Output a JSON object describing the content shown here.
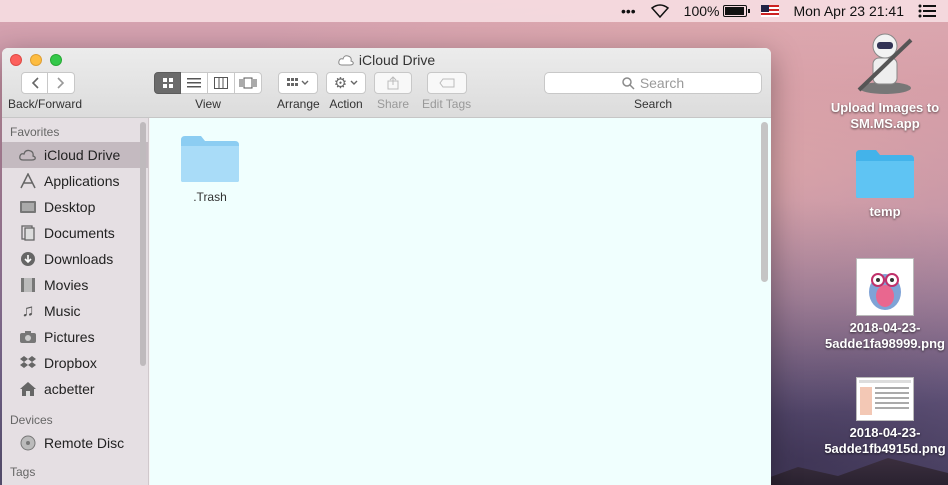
{
  "menubar": {
    "battery_percent_label": "100%",
    "battery_level": 1.0,
    "datetime": "Mon Apr 23  21:41"
  },
  "window": {
    "title": "iCloud Drive",
    "toolbar": {
      "back_forward_label": "Back/Forward",
      "view_label": "View",
      "arrange_label": "Arrange",
      "action_label": "Action",
      "share_label": "Share",
      "edit_tags_label": "Edit Tags",
      "search_label": "Search",
      "search_placeholder": "Search"
    }
  },
  "sidebar": {
    "favorites_heading": "Favorites",
    "favorites": [
      {
        "label": "iCloud Drive",
        "icon": "cloud-icon",
        "selected": true
      },
      {
        "label": "Applications",
        "icon": "applications-icon"
      },
      {
        "label": "Desktop",
        "icon": "desktop-icon"
      },
      {
        "label": "Documents",
        "icon": "documents-icon"
      },
      {
        "label": "Downloads",
        "icon": "downloads-icon"
      },
      {
        "label": "Movies",
        "icon": "movies-icon"
      },
      {
        "label": "Music",
        "icon": "music-icon"
      },
      {
        "label": "Pictures",
        "icon": "pictures-icon"
      },
      {
        "label": "Dropbox",
        "icon": "dropbox-icon"
      },
      {
        "label": "acbetter",
        "icon": "home-icon"
      }
    ],
    "devices_heading": "Devices",
    "devices": [
      {
        "label": "Remote Disc",
        "icon": "disc-icon"
      }
    ],
    "tags_heading": "Tags"
  },
  "content": {
    "items": [
      {
        "name": ".Trash",
        "icon": "folder-icon"
      }
    ]
  },
  "desktop": {
    "icons": [
      {
        "label": "Upload Images to SM.MS.app",
        "icon": "automator-robot-icon"
      },
      {
        "label": "temp",
        "icon": "folder-icon"
      },
      {
        "label": "2018-04-23-5adde1fa98999.png",
        "icon": "owl-image-thumbnail"
      },
      {
        "label": "2018-04-23-5adde1fb4915d.png",
        "icon": "screenshot-thumbnail"
      }
    ]
  },
  "colors": {
    "folder_blue": "#8ccdf2",
    "selection_gray": "#beb4ba",
    "content_bg": "#f0fffe"
  }
}
